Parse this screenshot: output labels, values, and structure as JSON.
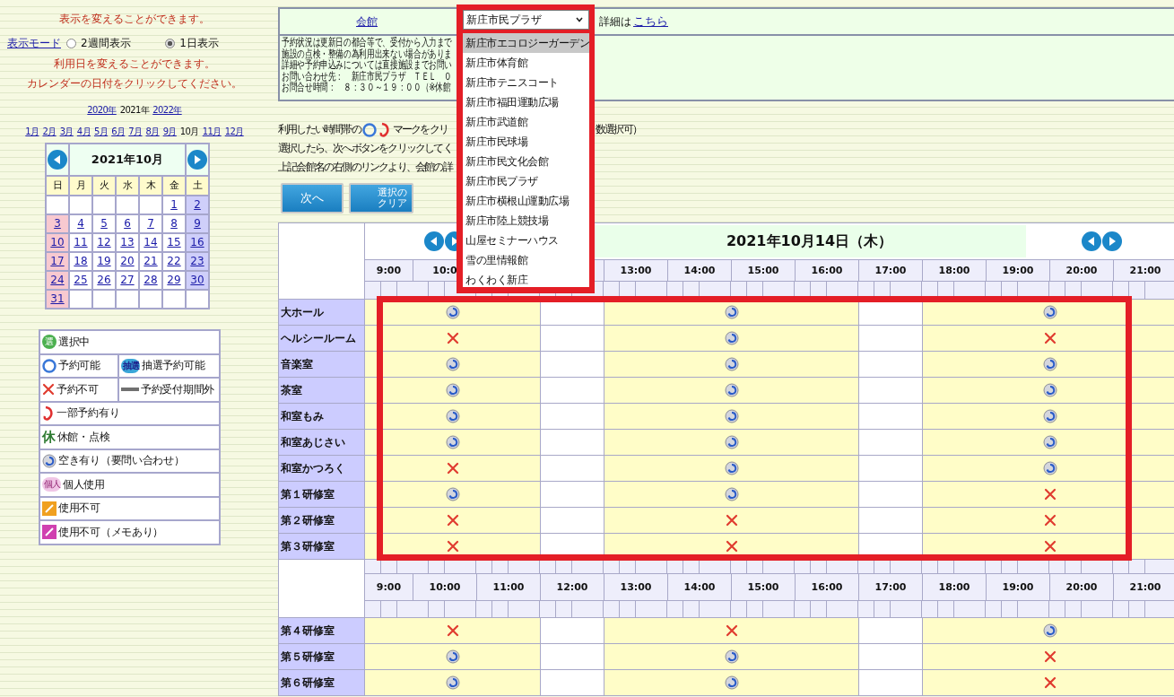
{
  "left": {
    "notice_display": "表示を変えることができます。",
    "display_mode": {
      "label": "表示モード",
      "options": [
        {
          "label": "2週間表示",
          "selected": false
        },
        {
          "label": "1日表示",
          "selected": true
        }
      ]
    },
    "notice_date": [
      "利用日を変えることができます。",
      "カレンダーの日付をクリックしてください。"
    ],
    "years": [
      {
        "label": "2020年",
        "current": false
      },
      {
        "label": "2021年",
        "current": true
      },
      {
        "label": "2022年",
        "current": false
      }
    ],
    "months": [
      {
        "label": "1月",
        "current": false
      },
      {
        "label": "2月",
        "current": false
      },
      {
        "label": "3月",
        "current": false
      },
      {
        "label": "4月",
        "current": false
      },
      {
        "label": "5月",
        "current": false
      },
      {
        "label": "6月",
        "current": false
      },
      {
        "label": "7月",
        "current": false
      },
      {
        "label": "8月",
        "current": false
      },
      {
        "label": "9月",
        "current": false
      },
      {
        "label": "10月",
        "current": true
      },
      {
        "label": "11月",
        "current": false
      },
      {
        "label": "12月",
        "current": false
      }
    ],
    "calendar": {
      "title": "2021年10月",
      "weekdays": [
        "日",
        "月",
        "火",
        "水",
        "木",
        "金",
        "土"
      ],
      "weeks": [
        {
          "kind": "first",
          "days": [
            "1",
            "2"
          ]
        },
        {
          "kind": "full",
          "days": [
            "3",
            "4",
            "5",
            "6",
            "7",
            "8",
            "9"
          ]
        },
        {
          "kind": "full",
          "days": [
            "10",
            "11",
            "12",
            "13",
            "14",
            "15",
            "16"
          ]
        },
        {
          "kind": "full",
          "days": [
            "17",
            "18",
            "19",
            "20",
            "21",
            "22",
            "23"
          ]
        },
        {
          "kind": "full",
          "days": [
            "24",
            "25",
            "26",
            "27",
            "28",
            "29",
            "30"
          ]
        },
        {
          "kind": "last",
          "days": [
            "31"
          ]
        }
      ]
    },
    "legend": [
      [
        {
          "kind": "selected",
          "label": "選択中",
          "icon_text": "選"
        }
      ],
      [
        {
          "kind": "available",
          "label": "予約可能"
        },
        {
          "kind": "lottery",
          "label": "抽選予約可能",
          "icon_text": "抽選"
        }
      ],
      [
        {
          "kind": "unavailable",
          "label": "予約不可"
        },
        {
          "kind": "outside",
          "label": "予約受付期間外"
        }
      ],
      [
        {
          "kind": "partial",
          "label": "一部予約有り"
        }
      ],
      [
        {
          "kind": "closed",
          "label": "休館・点検",
          "icon_text": "休"
        }
      ],
      [
        {
          "kind": "inquiry",
          "label": "空き有り（要問い合わせ）"
        }
      ],
      [
        {
          "kind": "personal",
          "label": "個人使用",
          "icon_text": "個人"
        }
      ],
      [
        {
          "kind": "unusable",
          "label": "使用不可"
        }
      ],
      [
        {
          "kind": "unusable_memo",
          "label": "使用不可（メモあり）"
        }
      ]
    ]
  },
  "facility": {
    "label": "会館",
    "detail_text": "詳細は",
    "detail_link": "こちら",
    "select": {
      "value": "新庄市民プラザ",
      "expanded": true,
      "options": [
        {
          "label": "新庄市エコロジーガーデン",
          "highlighted": true
        },
        {
          "label": "新庄市体育館",
          "highlighted": false
        },
        {
          "label": "新庄市テニスコート",
          "highlighted": false
        },
        {
          "label": "新庄市福田運動広場",
          "highlighted": false
        },
        {
          "label": "新庄市武道館",
          "highlighted": false
        },
        {
          "label": "新庄市民球場",
          "highlighted": false
        },
        {
          "label": "新庄市民文化会館",
          "highlighted": false
        },
        {
          "label": "新庄市民プラザ",
          "highlighted": false
        },
        {
          "label": "新庄市横根山運動広場",
          "highlighted": false
        },
        {
          "label": "新庄市陸上競技場",
          "highlighted": false
        },
        {
          "label": "山屋セミナーハウス",
          "highlighted": false
        },
        {
          "label": "雪の里情報館",
          "highlighted": false
        },
        {
          "label": "わくわく新庄",
          "highlighted": false
        }
      ]
    }
  },
  "notice_lines": [
    "予約状況は更新日の都合等で、受付から入力まで",
    "施設の点検・整備の為利用出来ない場合がありま",
    "詳細や予約申込みについては直接施設までお問い",
    "お問い合わせ先：　新庄市民プラザ　ＴＥＬ　０",
    "お問合せ時間：　８：３０～１９：００（※休館"
  ],
  "instructions": {
    "first": {
      "start": "利用したい時間帯の",
      "middle": "マークをクリ",
      "end": "数選択可）"
    },
    "lines": [
      "選択したら、次へボタンをクリックしてく",
      "上記会館名の右側のリンクより、会館の詳"
    ]
  },
  "buttons": {
    "next": "次へ",
    "clear": "選択のクリア"
  },
  "grid": {
    "sections": [
      {
        "date": "2021年10月14日（木）",
        "hours_left": [
          "9:00",
          "10:0"
        ],
        "hours_right": [
          "13:00",
          "14:00",
          "15:00",
          "16:00",
          "17:00",
          "18:00",
          "19:00",
          "20:00",
          "21:00"
        ],
        "rooms": [
          {
            "name": "大ホール",
            "slots": [
              {
                "kind": "inquiry"
              },
              {
                "kind": "inquiry"
              },
              {
                "kind": "inquiry"
              }
            ]
          },
          {
            "name": "ヘルシールーム",
            "slots": [
              {
                "kind": "unavailable"
              },
              {
                "kind": "inquiry"
              },
              {
                "kind": "unavailable"
              }
            ]
          },
          {
            "name": "音楽室",
            "slots": [
              {
                "kind": "inquiry"
              },
              {
                "kind": "inquiry"
              },
              {
                "kind": "inquiry"
              }
            ]
          },
          {
            "name": "茶室",
            "slots": [
              {
                "kind": "inquiry"
              },
              {
                "kind": "inquiry"
              },
              {
                "kind": "inquiry"
              }
            ]
          },
          {
            "name": "和室もみ",
            "slots": [
              {
                "kind": "inquiry"
              },
              {
                "kind": "inquiry"
              },
              {
                "kind": "inquiry"
              }
            ]
          },
          {
            "name": "和室あじさい",
            "slots": [
              {
                "kind": "inquiry"
              },
              {
                "kind": "inquiry"
              },
              {
                "kind": "inquiry"
              }
            ]
          },
          {
            "name": "和室かつろく",
            "slots": [
              {
                "kind": "unavailable"
              },
              {
                "kind": "inquiry"
              },
              {
                "kind": "inquiry"
              }
            ]
          },
          {
            "name": "第１研修室",
            "slots": [
              {
                "kind": "inquiry"
              },
              {
                "kind": "inquiry"
              },
              {
                "kind": "unavailable"
              }
            ]
          },
          {
            "name": "第２研修室",
            "slots": [
              {
                "kind": "unavailable"
              },
              {
                "kind": "unavailable"
              },
              {
                "kind": "unavailable"
              }
            ]
          },
          {
            "name": "第３研修室",
            "slots": [
              {
                "kind": "unavailable"
              },
              {
                "kind": "unavailable"
              },
              {
                "kind": "unavailable"
              }
            ]
          }
        ]
      },
      {
        "hours": [
          "9:00",
          "10:00",
          "11:00",
          "12:00",
          "13:00",
          "14:00",
          "15:00",
          "16:00",
          "17:00",
          "18:00",
          "19:00",
          "20:00",
          "21:00"
        ],
        "rooms": [
          {
            "name": "第４研修室",
            "slots": [
              {
                "kind": "unavailable"
              },
              {
                "kind": "unavailable"
              },
              {
                "kind": "inquiry"
              }
            ]
          },
          {
            "name": "第５研修室",
            "slots": [
              {
                "kind": "inquiry"
              },
              {
                "kind": "inquiry"
              },
              {
                "kind": "unavailable"
              }
            ]
          },
          {
            "name": "第６研修室",
            "slots": [
              {
                "kind": "inquiry"
              },
              {
                "kind": "inquiry"
              },
              {
                "kind": "unavailable"
              }
            ]
          }
        ]
      }
    ]
  }
}
